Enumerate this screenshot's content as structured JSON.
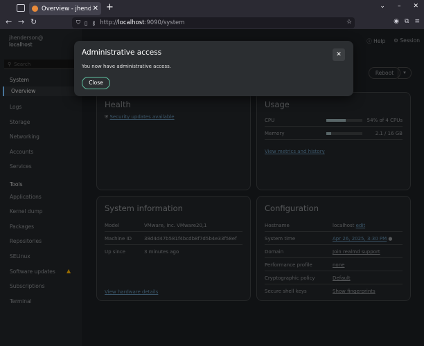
{
  "browser": {
    "tab_title": "Overview - jhenderson@",
    "tab_close": "✕",
    "new_tab": "+",
    "url_prefix": "http://",
    "url_host": "localhost",
    "url_rest": ":9090/system",
    "icons": [
      "back-icon",
      "forward-icon",
      "reload-icon",
      "shield-icon",
      "page-icon",
      "key-icon",
      "bookmark-star-icon",
      "account-icon",
      "extensions-icon",
      "menu-icon"
    ]
  },
  "sidebar": {
    "user": "jhenderson@",
    "host": "localhost",
    "search_placeholder": "Search",
    "section_system": "System",
    "items_system": [
      "Overview",
      "Logs",
      "Storage",
      "Networking",
      "Accounts",
      "Services"
    ],
    "section_tools": "Tools",
    "items_tools": [
      "Applications",
      "Kernel dump",
      "Packages",
      "Repositories",
      "SELinux",
      "Software updates",
      "Subscriptions",
      "Terminal"
    ]
  },
  "header": {
    "help": "Help",
    "session": "Session"
  },
  "actions": {
    "reboot": "Reboot"
  },
  "health": {
    "title": "Health",
    "security_updates": "Security updates available"
  },
  "usage": {
    "title": "Usage",
    "cpu_label": "CPU",
    "cpu_value": "54% of 4 CPUs",
    "cpu_fraction": 0.54,
    "memory_label": "Memory",
    "memory_value": "2.1 / 16 GB",
    "memory_fraction": 0.13,
    "link": "View metrics and history"
  },
  "sysinfo": {
    "title": "System information",
    "model_label": "Model",
    "model_value": "VMware, Inc. VMware20,1",
    "machine_label": "Machine ID",
    "machine_value": "38d4d47b581f4bcdb8f7d5b4e33f58ef",
    "uptime_label": "Up since",
    "uptime_value": "3 minutes ago",
    "link": "View hardware details"
  },
  "config": {
    "title": "Configuration",
    "hostname_label": "Hostname",
    "hostname_value": "localhost",
    "hostname_edit": "edit",
    "time_label": "System time",
    "time_value": "Apr 26, 2025, 3:30 PM",
    "domain_label": "Domain",
    "domain_value": "Join realmd support",
    "perf_label": "Performance profile",
    "perf_value": "none",
    "crypto_label": "Cryptographic policy",
    "crypto_value": "Default",
    "ssh_label": "Secure shell keys",
    "ssh_value": "Show fingerprints"
  },
  "modal": {
    "title": "Administrative access",
    "body": "You now have administrative access.",
    "close_button": "Close",
    "close_icon": "✕"
  }
}
